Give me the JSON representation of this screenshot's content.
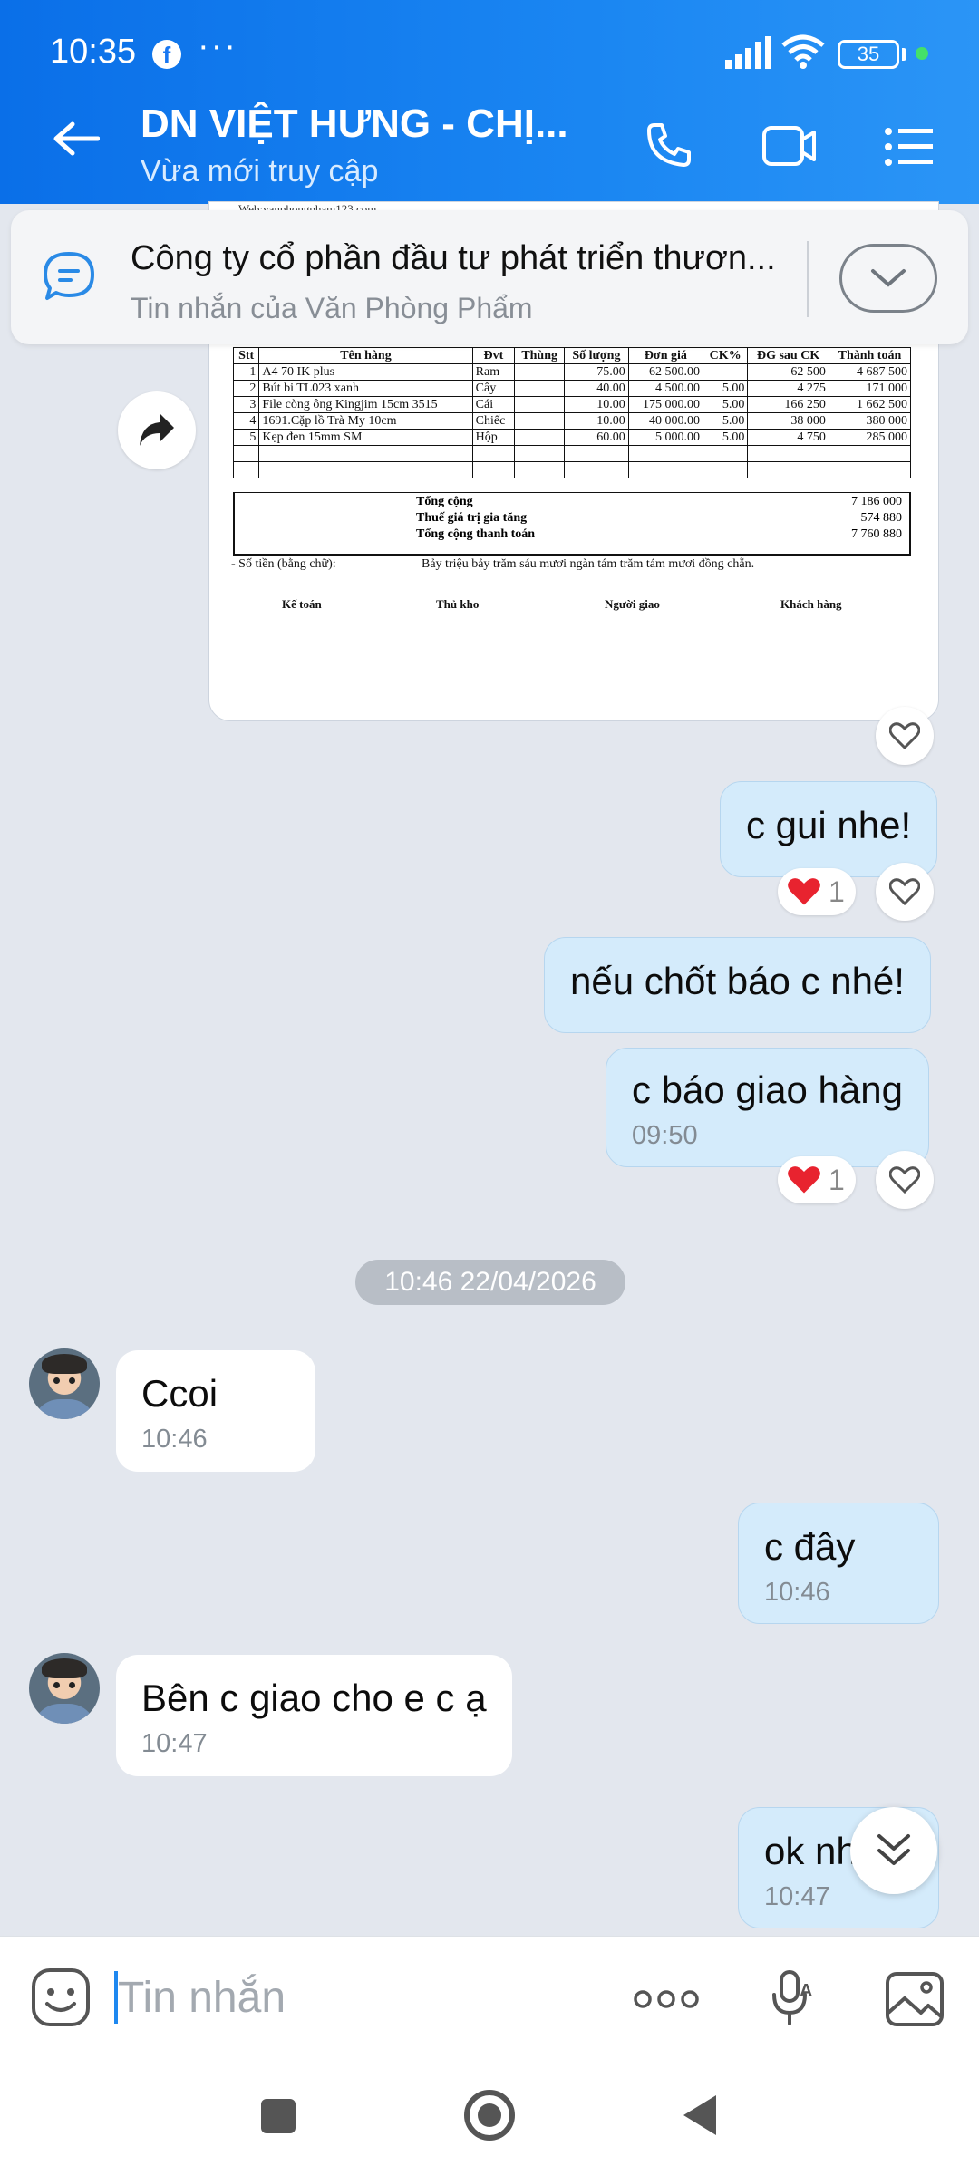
{
  "status_bar": {
    "time": "10:35",
    "battery": "35"
  },
  "header": {
    "title": "DN VIỆT HƯNG - CHỊ...",
    "subtitle": "Vừa mới truy cập"
  },
  "pinned": {
    "title": "Công ty cổ phần đầu tư phát triển thươn...",
    "source": "Tin nhắn của Văn Phòng Phẩm"
  },
  "document": {
    "web": "Web:vanphongpham123.com.",
    "columns": [
      "Stt",
      "Tên hàng",
      "Đvt",
      "Thùng",
      "Số lượng",
      "Đơn giá",
      "CK%",
      "ĐG sau CK",
      "Thành toán"
    ],
    "rows": [
      [
        "1",
        "A4 70 IK plus",
        "Ram",
        "",
        "75.00",
        "62 500.00",
        "",
        "62 500",
        "4 687 500"
      ],
      [
        "2",
        "Bút bi TL023 xanh",
        "Cây",
        "",
        "40.00",
        "4 500.00",
        "5.00",
        "4 275",
        "171 000"
      ],
      [
        "3",
        "File còng ông Kingjim 15cm 3515",
        "Cái",
        "",
        "10.00",
        "175 000.00",
        "5.00",
        "166 250",
        "1 662 500"
      ],
      [
        "4",
        "1691.Cặp lồ Trà My 10cm",
        "Chiếc",
        "",
        "10.00",
        "40 000.00",
        "5.00",
        "38 000",
        "380 000"
      ],
      [
        "5",
        "Kẹp đen 15mm SM",
        "Hộp",
        "",
        "60.00",
        "5 000.00",
        "5.00",
        "4 750",
        "285 000"
      ]
    ],
    "totals": [
      {
        "label": "Tổng cộng",
        "value": "7 186 000"
      },
      {
        "label": "Thuế giá trị gia tăng",
        "value": "574 880"
      },
      {
        "label": "Tổng cộng thanh toán",
        "value": "7 760 880"
      }
    ],
    "words_label": "- Số tiền (bằng chữ):",
    "words_value": "Bảy triệu bảy trăm sáu mươi ngàn tám trăm tám mươi đồng chẵn.",
    "signers": [
      "Kế toán",
      "Thủ kho",
      "Người giao",
      "Khách hàng"
    ]
  },
  "messages": [
    {
      "text": "c gui nhe!",
      "reaction_count": "1"
    },
    {
      "text": "nếu chốt báo c nhé!"
    },
    {
      "text": "c báo giao hàng",
      "time": "09:50",
      "reaction_count": "1"
    },
    {
      "date": "10:46 22/04/2026"
    },
    {
      "text": "Ccoi",
      "time": "10:46"
    },
    {
      "text": "c đây",
      "time": "10:46"
    },
    {
      "text": "Bên c giao cho e c ạ",
      "time": "10:47"
    },
    {
      "text": "ok nh",
      "time": "10:47"
    }
  ],
  "composer": {
    "placeholder": "Tin nhắn"
  }
}
